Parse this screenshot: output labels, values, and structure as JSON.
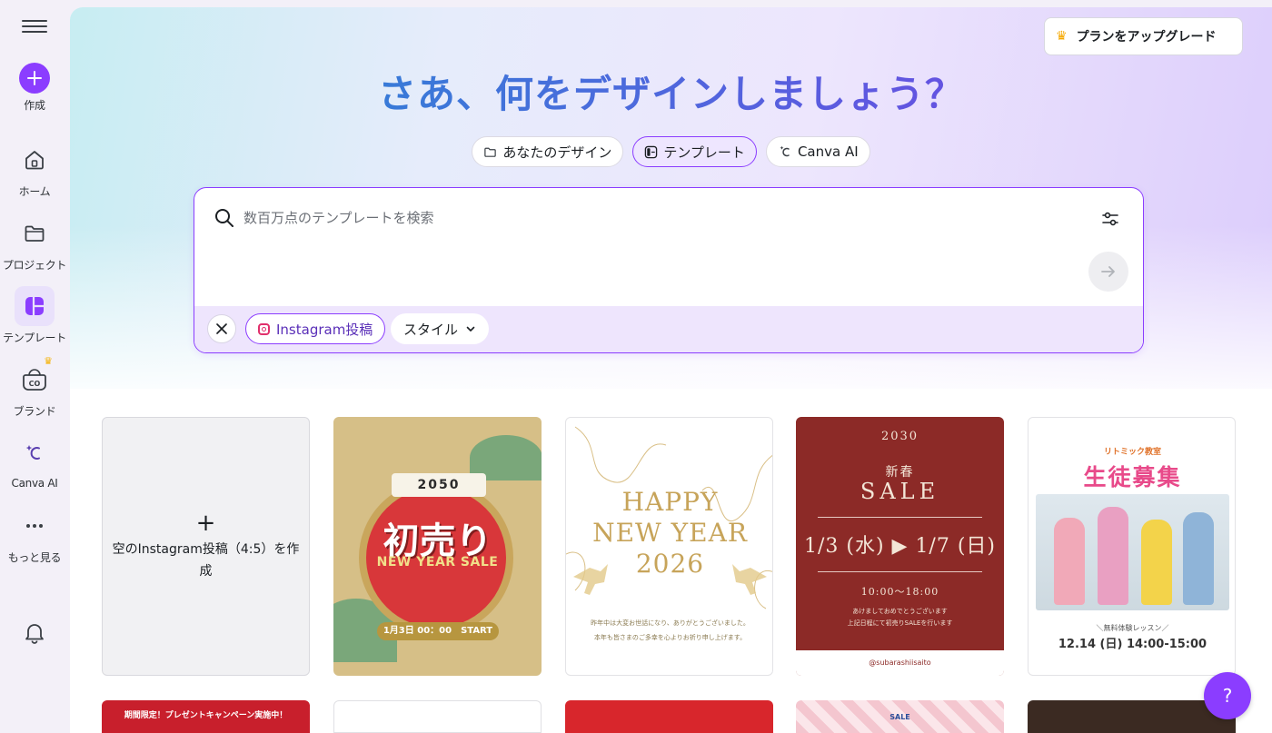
{
  "sidebar": {
    "create_label": "作成",
    "items": [
      {
        "label": "ホーム",
        "icon": "home-icon"
      },
      {
        "label": "プロジェクト",
        "icon": "folder-icon"
      },
      {
        "label": "テンプレート",
        "icon": "template-icon",
        "active": true
      },
      {
        "label": "ブランド",
        "icon": "brand-icon"
      },
      {
        "label": "Canva AI",
        "icon": "canva-ai-icon"
      },
      {
        "label": "もっと見る",
        "icon": "more-icon"
      }
    ]
  },
  "header": {
    "upgrade_label": "プランをアップグレード"
  },
  "hero": {
    "title": "さあ、何をデザインしましょう？",
    "tabs": [
      {
        "label": "あなたのデザイン",
        "icon": "folder-icon"
      },
      {
        "label": "テンプレート",
        "icon": "template-icon",
        "active": true
      },
      {
        "label": "Canva AI",
        "icon": "canva-ai-icon"
      }
    ]
  },
  "search": {
    "placeholder": "数百万点のテンプレートを検索",
    "value": "",
    "filter_chip": "Instagram投稿",
    "style_dropdown": "スタイル"
  },
  "templates": {
    "blank_card": {
      "label": "空のInstagram投稿（4:5）を作成"
    },
    "cards": [
      {
        "name": "new-year-sale-2050",
        "year": "2050",
        "headline": "初売り",
        "subhead": "NEW YEAR SALE",
        "date": "1月3日 00：00　START"
      },
      {
        "name": "happy-new-year-2026",
        "lines": [
          "HAPPY",
          "NEW YEAR",
          "2026"
        ],
        "message": "昨年中は大変お世話になり、ありがとうございました。\n本年も皆さまのご多幸を心よりお祈り申し上げます。"
      },
      {
        "name": "shinshun-sale-2030",
        "year": "2030",
        "title_jp": "新春",
        "title_en": "SALE",
        "dates": "1/3 (水) ▶ 1/7 (日)",
        "time": "10:00〜18:00",
        "message": "あけましておめでとうございます\n上記日程にて初売りSALEを行います",
        "handle": "@subarashiisaito"
      },
      {
        "name": "rhythmic-class-recruit",
        "school": "リトミック教室",
        "headline": "生徒募集",
        "lesson": "＼無料体験レッスン／",
        "datetime": "12.14 (日) 14:00-15:00"
      }
    ],
    "row2": [
      {
        "text": "期間限定！プレゼントキャンペーン実施中！"
      },
      {
        "text": ""
      },
      {
        "text": ""
      },
      {
        "text": "SALE"
      },
      {
        "text": ""
      }
    ]
  },
  "help": {
    "label": "?"
  },
  "colors": {
    "accent": "#8b3dff",
    "sidebar_bg": "#f3f0f8",
    "active_nav_bg": "#e9e1fb"
  }
}
